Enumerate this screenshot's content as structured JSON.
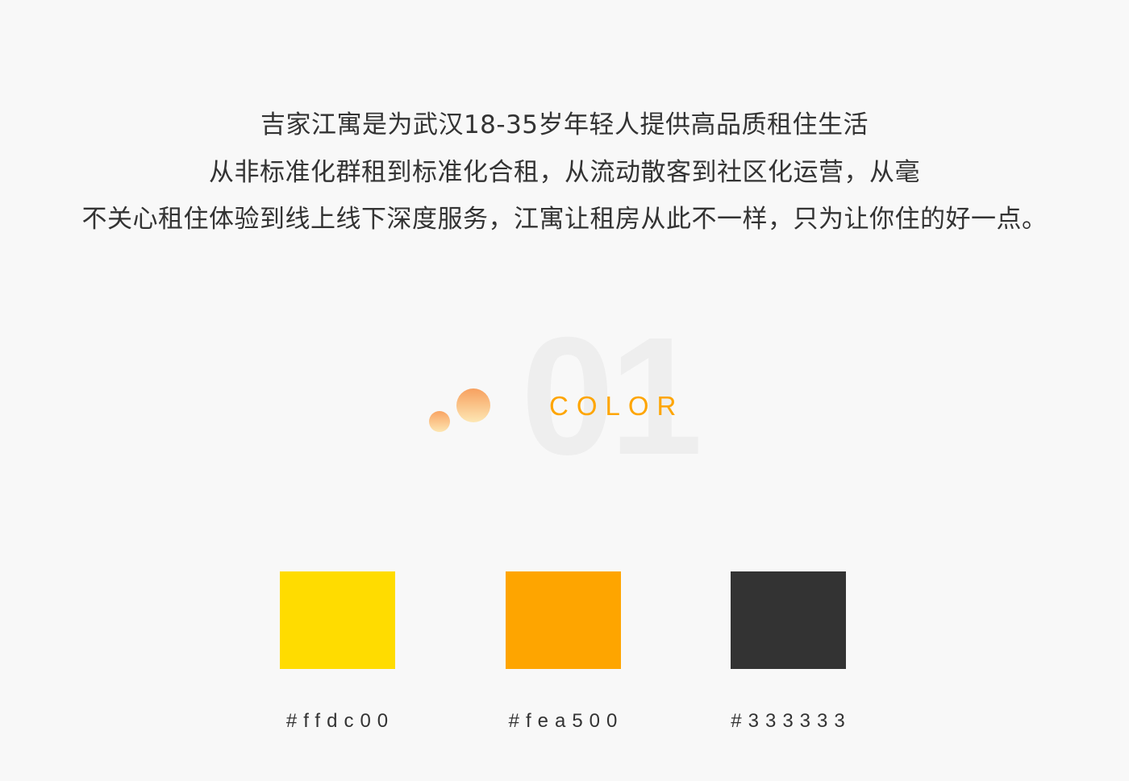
{
  "intro": {
    "lines": [
      "吉家江寓是为武汉18-35岁年轻人提供高品质租住生活",
      "从非标准化群租到标准化合租，从流动散客到社区化运营，从毫",
      "不关心租住体验到线上线下深度服务，江寓让租房从此不一样，只为让你住的好一点。"
    ]
  },
  "section": {
    "number": "01",
    "title": "COLOR"
  },
  "palette": [
    {
      "label": "#ffdc00",
      "color": "#ffdc00"
    },
    {
      "label": "#fea500",
      "color": "#fea500"
    },
    {
      "label": "#333333",
      "color": "#333333"
    }
  ]
}
